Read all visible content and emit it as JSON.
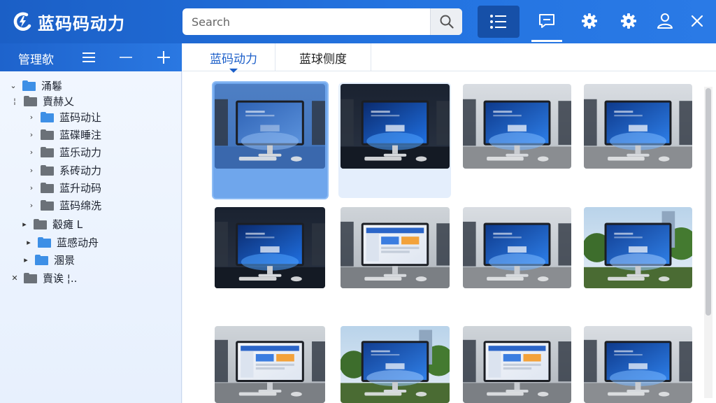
{
  "header": {
    "app_title": "蓝码码动力",
    "search_placeholder": "Search",
    "buttons": [
      {
        "name": "list-view",
        "icon": "list-icon",
        "active": true
      },
      {
        "name": "comment",
        "icon": "comment-icon",
        "active": false
      },
      {
        "name": "settings",
        "icon": "gear-icon",
        "active": false
      },
      {
        "name": "settings-2",
        "icon": "gear-icon",
        "active": false
      },
      {
        "name": "user",
        "icon": "user-icon",
        "active": false
      },
      {
        "name": "close",
        "icon": "close-icon",
        "active": false
      }
    ]
  },
  "left_panel": {
    "title": "管理欹",
    "buttons": [
      "menu-icon",
      "minus-icon",
      "plus-icon"
    ],
    "tree": [
      {
        "label": "涌鬈",
        "toggle": "⌄",
        "folder": "blue",
        "level": 0
      },
      {
        "label": "賣赫乂",
        "toggle": "¦",
        "folder": "gray",
        "level": 0
      },
      {
        "label": "蓝码动让",
        "toggle": "›",
        "folder": "blue",
        "level": 1
      },
      {
        "label": "蓝碟睡注",
        "toggle": "›",
        "folder": "gray",
        "level": 1
      },
      {
        "label": "蓝乐动力",
        "toggle": "›",
        "folder": "gray",
        "level": 1
      },
      {
        "label": "系砖动力",
        "toggle": "›",
        "folder": "gray",
        "level": 1
      },
      {
        "label": "蓝升动码",
        "toggle": "›",
        "folder": "gray",
        "level": 1
      },
      {
        "label": "蓝码绵洗",
        "toggle": "›",
        "folder": "gray",
        "level": 1
      },
      {
        "label": "觳瘫 L",
        "toggle": "▸",
        "folder": "gray",
        "level": "0b"
      },
      {
        "label": "蓝感动舟",
        "toggle": "▸",
        "folder": "blue",
        "level": "0c"
      },
      {
        "label": "溷景",
        "toggle": "▸",
        "folder": "blue",
        "level": "0b"
      },
      {
        "label": "賣诶   ¦..",
        "toggle": "✕",
        "folder": "gray",
        "level": 0
      }
    ]
  },
  "tabs": [
    {
      "label": "蓝码动力",
      "active": true
    },
    {
      "label": "蓝球侧度",
      "active": false
    }
  ],
  "thumbnails": [
    {
      "variant": "faded",
      "state": "selected"
    },
    {
      "variant": "dark",
      "state": "hover"
    },
    {
      "variant": "room",
      "state": "normal"
    },
    {
      "variant": "room",
      "state": "normal"
    },
    {
      "variant": "dark",
      "state": "normal"
    },
    {
      "variant": "web",
      "state": "normal"
    },
    {
      "variant": "room",
      "state": "normal"
    },
    {
      "variant": "outdoor",
      "state": "normal"
    },
    {
      "variant": "web",
      "state": "normal"
    },
    {
      "variant": "outdoor",
      "state": "normal"
    },
    {
      "variant": "web",
      "state": "normal"
    },
    {
      "variant": "room",
      "state": "normal"
    }
  ],
  "colors": {
    "header": "#2373e0",
    "accent": "#1c5fc9",
    "selected": "#6fa6ec"
  }
}
